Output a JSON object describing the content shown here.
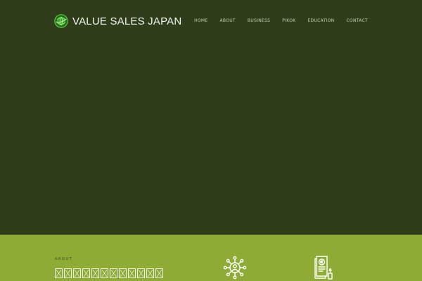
{
  "header": {
    "logo_text": "VALUE SALES JAPAN",
    "logo_icon": "globe-icon"
  },
  "nav": {
    "items": [
      {
        "label": "HOME"
      },
      {
        "label": "ABOUT"
      },
      {
        "label": "BUSINESS"
      },
      {
        "label": "PIKOK"
      },
      {
        "label": "EDUCATION"
      },
      {
        "label": "CONTACT"
      }
    ]
  },
  "about": {
    "label": "ABOUT",
    "heading_glyph_count": 12
  },
  "features": [
    {
      "icon": "network-person-icon"
    },
    {
      "icon": "contract-document-icon"
    }
  ],
  "colors": {
    "hero_background": "#2f3d1b",
    "band_background": "#8dab35",
    "logo_green": "#39a935",
    "nav_text": "#c5ceb7"
  }
}
